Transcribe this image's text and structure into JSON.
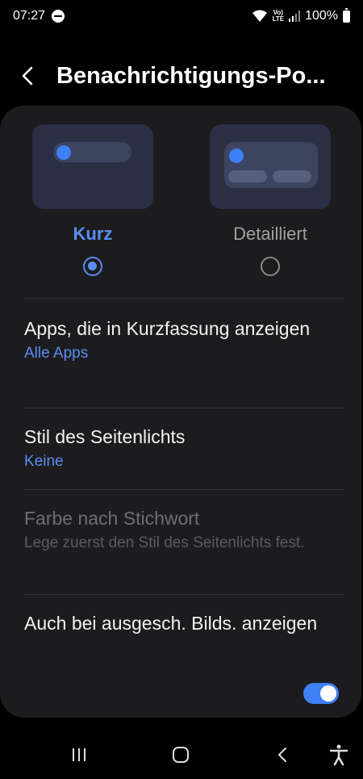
{
  "status_bar": {
    "time": "07:27",
    "volte": "Vo)",
    "lte": "LTE",
    "battery": "100%"
  },
  "header": {
    "title": "Benachrichtigungs-Po..."
  },
  "style_options": {
    "brief_label": "Kurz",
    "detailed_label": "Detailliert",
    "selected": "brief"
  },
  "rows": {
    "apps_title": "Apps, die in Kurzfassung anzeigen",
    "apps_value": "Alle Apps",
    "edge_title": "Stil des Seitenlichts",
    "edge_value": "Keine",
    "keyword_title": "Farbe nach Stichwort",
    "keyword_sub": "Lege zuerst den Stil des Seitenlichts fest.",
    "screen_off_title": "Auch bei ausgesch. Bilds. anzeigen",
    "screen_off_enabled": true
  },
  "colors": {
    "accent": "#3e80f5",
    "link": "#5a8df2",
    "card": "#1c1c1e"
  }
}
